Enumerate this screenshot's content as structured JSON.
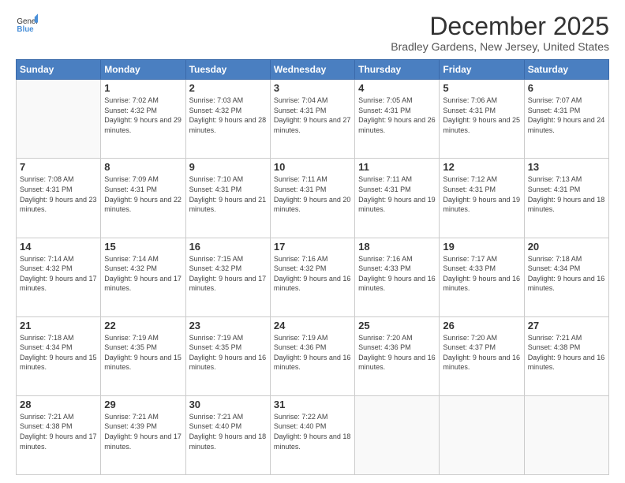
{
  "logo": {
    "general": "General",
    "blue": "Blue"
  },
  "title": "December 2025",
  "subtitle": "Bradley Gardens, New Jersey, United States",
  "days_header": [
    "Sunday",
    "Monday",
    "Tuesday",
    "Wednesday",
    "Thursday",
    "Friday",
    "Saturday"
  ],
  "weeks": [
    [
      {
        "num": "",
        "empty": true
      },
      {
        "num": "1",
        "sunrise": "Sunrise: 7:02 AM",
        "sunset": "Sunset: 4:32 PM",
        "daylight": "Daylight: 9 hours and 29 minutes."
      },
      {
        "num": "2",
        "sunrise": "Sunrise: 7:03 AM",
        "sunset": "Sunset: 4:32 PM",
        "daylight": "Daylight: 9 hours and 28 minutes."
      },
      {
        "num": "3",
        "sunrise": "Sunrise: 7:04 AM",
        "sunset": "Sunset: 4:31 PM",
        "daylight": "Daylight: 9 hours and 27 minutes."
      },
      {
        "num": "4",
        "sunrise": "Sunrise: 7:05 AM",
        "sunset": "Sunset: 4:31 PM",
        "daylight": "Daylight: 9 hours and 26 minutes."
      },
      {
        "num": "5",
        "sunrise": "Sunrise: 7:06 AM",
        "sunset": "Sunset: 4:31 PM",
        "daylight": "Daylight: 9 hours and 25 minutes."
      },
      {
        "num": "6",
        "sunrise": "Sunrise: 7:07 AM",
        "sunset": "Sunset: 4:31 PM",
        "daylight": "Daylight: 9 hours and 24 minutes."
      }
    ],
    [
      {
        "num": "7",
        "sunrise": "Sunrise: 7:08 AM",
        "sunset": "Sunset: 4:31 PM",
        "daylight": "Daylight: 9 hours and 23 minutes."
      },
      {
        "num": "8",
        "sunrise": "Sunrise: 7:09 AM",
        "sunset": "Sunset: 4:31 PM",
        "daylight": "Daylight: 9 hours and 22 minutes."
      },
      {
        "num": "9",
        "sunrise": "Sunrise: 7:10 AM",
        "sunset": "Sunset: 4:31 PM",
        "daylight": "Daylight: 9 hours and 21 minutes."
      },
      {
        "num": "10",
        "sunrise": "Sunrise: 7:11 AM",
        "sunset": "Sunset: 4:31 PM",
        "daylight": "Daylight: 9 hours and 20 minutes."
      },
      {
        "num": "11",
        "sunrise": "Sunrise: 7:11 AM",
        "sunset": "Sunset: 4:31 PM",
        "daylight": "Daylight: 9 hours and 19 minutes."
      },
      {
        "num": "12",
        "sunrise": "Sunrise: 7:12 AM",
        "sunset": "Sunset: 4:31 PM",
        "daylight": "Daylight: 9 hours and 19 minutes."
      },
      {
        "num": "13",
        "sunrise": "Sunrise: 7:13 AM",
        "sunset": "Sunset: 4:31 PM",
        "daylight": "Daylight: 9 hours and 18 minutes."
      }
    ],
    [
      {
        "num": "14",
        "sunrise": "Sunrise: 7:14 AM",
        "sunset": "Sunset: 4:32 PM",
        "daylight": "Daylight: 9 hours and 17 minutes."
      },
      {
        "num": "15",
        "sunrise": "Sunrise: 7:14 AM",
        "sunset": "Sunset: 4:32 PM",
        "daylight": "Daylight: 9 hours and 17 minutes."
      },
      {
        "num": "16",
        "sunrise": "Sunrise: 7:15 AM",
        "sunset": "Sunset: 4:32 PM",
        "daylight": "Daylight: 9 hours and 17 minutes."
      },
      {
        "num": "17",
        "sunrise": "Sunrise: 7:16 AM",
        "sunset": "Sunset: 4:32 PM",
        "daylight": "Daylight: 9 hours and 16 minutes."
      },
      {
        "num": "18",
        "sunrise": "Sunrise: 7:16 AM",
        "sunset": "Sunset: 4:33 PM",
        "daylight": "Daylight: 9 hours and 16 minutes."
      },
      {
        "num": "19",
        "sunrise": "Sunrise: 7:17 AM",
        "sunset": "Sunset: 4:33 PM",
        "daylight": "Daylight: 9 hours and 16 minutes."
      },
      {
        "num": "20",
        "sunrise": "Sunrise: 7:18 AM",
        "sunset": "Sunset: 4:34 PM",
        "daylight": "Daylight: 9 hours and 16 minutes."
      }
    ],
    [
      {
        "num": "21",
        "sunrise": "Sunrise: 7:18 AM",
        "sunset": "Sunset: 4:34 PM",
        "daylight": "Daylight: 9 hours and 15 minutes."
      },
      {
        "num": "22",
        "sunrise": "Sunrise: 7:19 AM",
        "sunset": "Sunset: 4:35 PM",
        "daylight": "Daylight: 9 hours and 15 minutes."
      },
      {
        "num": "23",
        "sunrise": "Sunrise: 7:19 AM",
        "sunset": "Sunset: 4:35 PM",
        "daylight": "Daylight: 9 hours and 16 minutes."
      },
      {
        "num": "24",
        "sunrise": "Sunrise: 7:19 AM",
        "sunset": "Sunset: 4:36 PM",
        "daylight": "Daylight: 9 hours and 16 minutes."
      },
      {
        "num": "25",
        "sunrise": "Sunrise: 7:20 AM",
        "sunset": "Sunset: 4:36 PM",
        "daylight": "Daylight: 9 hours and 16 minutes."
      },
      {
        "num": "26",
        "sunrise": "Sunrise: 7:20 AM",
        "sunset": "Sunset: 4:37 PM",
        "daylight": "Daylight: 9 hours and 16 minutes."
      },
      {
        "num": "27",
        "sunrise": "Sunrise: 7:21 AM",
        "sunset": "Sunset: 4:38 PM",
        "daylight": "Daylight: 9 hours and 16 minutes."
      }
    ],
    [
      {
        "num": "28",
        "sunrise": "Sunrise: 7:21 AM",
        "sunset": "Sunset: 4:38 PM",
        "daylight": "Daylight: 9 hours and 17 minutes."
      },
      {
        "num": "29",
        "sunrise": "Sunrise: 7:21 AM",
        "sunset": "Sunset: 4:39 PM",
        "daylight": "Daylight: 9 hours and 17 minutes."
      },
      {
        "num": "30",
        "sunrise": "Sunrise: 7:21 AM",
        "sunset": "Sunset: 4:40 PM",
        "daylight": "Daylight: 9 hours and 18 minutes."
      },
      {
        "num": "31",
        "sunrise": "Sunrise: 7:22 AM",
        "sunset": "Sunset: 4:40 PM",
        "daylight": "Daylight: 9 hours and 18 minutes."
      },
      {
        "num": "",
        "empty": true
      },
      {
        "num": "",
        "empty": true
      },
      {
        "num": "",
        "empty": true
      }
    ]
  ]
}
